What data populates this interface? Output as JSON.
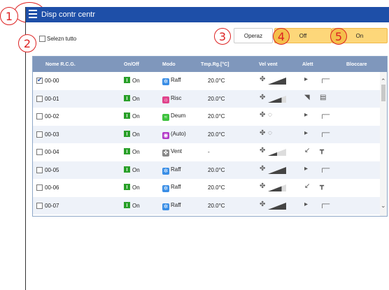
{
  "header": {
    "title": "Disp contr centr"
  },
  "toolbar": {
    "select_all_label": "Selezn tutto",
    "operaz_label": "Operaz",
    "off_label": "Off",
    "on_label": "On"
  },
  "callouts": [
    "1",
    "2",
    "3",
    "4",
    "5"
  ],
  "table": {
    "columns": [
      "Nome R.C.G.",
      "On/Off",
      "Modo",
      "Tmp.Rg.[°C]",
      "Vel vent",
      "Alett",
      "Bloccare"
    ],
    "rows": [
      {
        "checked": true,
        "name": "00-00",
        "onoff": "On",
        "mode": "Raff",
        "mode_icon": "snowflake-icon",
        "temp": "20.0°C",
        "fan_speed": 1.0,
        "vane": "swing"
      },
      {
        "checked": false,
        "name": "00-01",
        "onoff": "On",
        "mode": "Risc",
        "mode_icon": "sun-icon",
        "temp": "20.0°C",
        "fan_speed": 0.75,
        "vane": "wide"
      },
      {
        "checked": false,
        "name": "00-02",
        "onoff": "On",
        "mode": "Deum",
        "mode_icon": "drop-icon",
        "temp": "20.0°C",
        "fan_speed": "auto",
        "vane": "horizontal"
      },
      {
        "checked": false,
        "name": "00-03",
        "onoff": "On",
        "mode": "(Auto)",
        "mode_icon": "auto-icon",
        "temp": "20.0°C",
        "fan_speed": "auto",
        "vane": "horizontal"
      },
      {
        "checked": false,
        "name": "00-04",
        "onoff": "On",
        "mode": "Vent",
        "mode_icon": "fan-icon",
        "temp": "-",
        "fan_speed": 0.5,
        "vane": "down"
      },
      {
        "checked": false,
        "name": "00-05",
        "onoff": "On",
        "mode": "Raff",
        "mode_icon": "snowflake-icon",
        "temp": "20.0°C",
        "fan_speed": 1.0,
        "vane": "horizontal"
      },
      {
        "checked": false,
        "name": "00-06",
        "onoff": "On",
        "mode": "Raff",
        "mode_icon": "snowflake-icon",
        "temp": "20.0°C",
        "fan_speed": 0.75,
        "vane": "down"
      },
      {
        "checked": false,
        "name": "00-07",
        "onoff": "On",
        "mode": "Raff",
        "mode_icon": "snowflake-icon",
        "temp": "20.0°C",
        "fan_speed": 1.0,
        "vane": "horizontal"
      }
    ]
  },
  "colors": {
    "titlebar": "#1e4fa8",
    "table_header": "#7f97bc",
    "button_accent": "#fdd77a",
    "on_badge": "#2aa02a",
    "mode_cool": "#3a8ee6",
    "mode_heat": "#e0448c",
    "mode_dry": "#3ec23e",
    "mode_auto": "#b23ac8",
    "callout": "#dd2222"
  }
}
